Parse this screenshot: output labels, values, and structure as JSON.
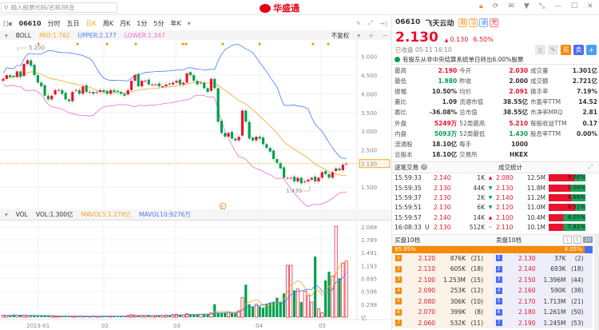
{
  "header": {
    "search_placeholder": "输入股票代码/名称/拼音",
    "logo_text": "华盛通"
  },
  "toolbar": {
    "code": "06610",
    "periods": [
      "分时",
      "五日",
      "日K",
      "周K",
      "月K",
      "1分",
      "5分",
      "年K"
    ],
    "active_period": "日K"
  },
  "boll": {
    "label": "BOLL",
    "mid": "MID:1.762",
    "upper": "UPPER:2.177",
    "lower": "LOWER:1.347",
    "adjust": "不复权"
  },
  "vol": {
    "label": "VOL",
    "vol": "VOL:1.300亿",
    "mavol5": "MAVOL5:1.278亿",
    "mavol10": "MAVOL10:9276万"
  },
  "colors": {
    "up": "#e8132d",
    "down": "#00a04e",
    "mid": "#f5a623",
    "upper": "#4a7cf7",
    "lower": "#f06bd0"
  },
  "chart_data": {
    "type": "candlestick",
    "price_ticks": [
      "5.000",
      "4.500",
      "4.000",
      "3.500",
      "3.000",
      "2.500",
      "1.500"
    ],
    "price_range": [
      1.0,
      5.45
    ],
    "last_price_label": "2.130",
    "high_label": "5.200",
    "low_label": "1.430",
    "x_labels": [
      "2023-01",
      "02",
      "03",
      "04",
      "05"
    ],
    "closes": [
      4.4,
      4.5,
      4.45,
      4.45,
      4.6,
      4.45,
      4.8,
      4.9,
      4.75,
      4.5,
      4.3,
      4.2,
      3.95,
      3.85,
      3.95,
      4.1,
      4.1,
      4.0,
      3.85,
      3.8,
      4.05,
      4.1,
      4.0,
      4.2,
      4.05,
      4.05,
      4.0,
      4.05,
      4.1,
      4.05,
      4.0,
      4.1,
      4.05,
      4.05,
      4.0,
      3.95,
      4.1,
      4.35,
      4.5,
      4.2,
      4.35,
      4.35,
      4.25,
      4.25,
      4.25,
      4.2,
      4.2,
      4.25,
      4.25,
      4.3,
      4.35,
      4.25,
      4.3,
      4.55,
      4.5,
      4.35,
      4.25,
      4.3,
      4.15,
      4.05,
      4.4,
      4.15,
      3.25,
      2.95,
      2.85,
      2.95,
      2.8,
      2.75,
      2.85,
      3.55,
      3.25,
      2.8,
      2.75,
      2.85,
      2.8,
      2.65,
      2.55,
      2.45,
      2.25,
      2.15,
      2.0,
      1.75,
      1.75,
      1.75,
      1.65,
      1.75,
      1.6,
      1.65,
      1.7,
      1.75,
      1.65,
      1.75,
      1.9,
      1.85,
      1.75,
      1.9,
      2.0,
      1.95,
      2.1,
      2.13
    ],
    "volume_ticks": [
      "2.088",
      "1.789",
      "1.491",
      "1.193",
      "0.895",
      "0.596",
      "0.298",
      "亿"
    ],
    "volume_range": [
      0,
      2.2
    ],
    "volumes": [
      0.05,
      0.04,
      0.03,
      0.06,
      0.05,
      0.04,
      0.05,
      0.04,
      0.03,
      0.04,
      0.03,
      0.03,
      0.04,
      0.03,
      0.03,
      0.02,
      0.02,
      0.03,
      0.03,
      0.02,
      0.02,
      0.03,
      0.02,
      0.03,
      0.02,
      0.02,
      0.03,
      0.02,
      0.02,
      0.03,
      0.02,
      0.03,
      0.03,
      0.02,
      0.03,
      0.03,
      0.04,
      0.06,
      0.05,
      0.04,
      0.05,
      0.04,
      0.04,
      0.04,
      0.03,
      0.04,
      0.04,
      0.05,
      0.05,
      0.06,
      0.07,
      0.06,
      0.06,
      0.08,
      0.07,
      0.06,
      0.06,
      0.07,
      0.08,
      0.08,
      0.1,
      0.3,
      0.1,
      0.1,
      0.1,
      0.1,
      0.1,
      0.1,
      0.15,
      0.45,
      0.75,
      0.3,
      0.25,
      0.3,
      0.25,
      0.22,
      0.3,
      0.33,
      0.35,
      0.45,
      0.35,
      0.55,
      1.2,
      1.2,
      0.62,
      0.65,
      0.35,
      0.6,
      0.5,
      0.35,
      1.4,
      0.2,
      0.1,
      0.85,
      1.05,
      0.95,
      2.1,
      0.9,
      1.25,
      1.3
    ]
  },
  "quote": {
    "code": "06610",
    "name": "飞天云动",
    "badges": [
      "融",
      "沽",
      "通",
      "完"
    ],
    "price": "2.130",
    "change": "0.130",
    "change_pct": "6.50%",
    "status": "已收盘 05-11 16:10",
    "notice": "有股东从非中央结算系统单日转出6.00%股票",
    "stats": [
      [
        {
          "l": "最高",
          "v": "2.190",
          "c": "red"
        },
        {
          "l": "今开",
          "v": "2.030",
          "c": "red"
        },
        {
          "l": "成交量",
          "v": "1.301亿",
          "c": ""
        }
      ],
      [
        {
          "l": "最低",
          "v": "1.980",
          "c": "grn"
        },
        {
          "l": "昨收",
          "v": "2.000",
          "c": ""
        },
        {
          "l": "成交额",
          "v": "2.721亿",
          "c": ""
        }
      ],
      [
        {
          "l": "振幅",
          "v": "10.50%",
          "c": ""
        },
        {
          "l": "均价",
          "v": "2.091",
          "c": "red"
        },
        {
          "l": "换手率",
          "v": "7.19%",
          "c": ""
        }
      ],
      [
        {
          "l": "量比",
          "v": "1.09",
          "c": ""
        },
        {
          "l": "流通市值",
          "v": "38.55亿",
          "c": ""
        },
        {
          "l": "市盈率TTM",
          "v": "14.52",
          "c": ""
        }
      ],
      [
        {
          "l": "委比",
          "v": "-36.08%",
          "c": ""
        },
        {
          "l": "总市值",
          "v": "38.55亿",
          "c": ""
        },
        {
          "l": "市净率MRQ",
          "v": "2.81",
          "c": ""
        }
      ],
      [
        {
          "l": "外盘",
          "v": "5249万",
          "c": "red"
        },
        {
          "l": "52周最高",
          "v": "5.210",
          "c": "red"
        },
        {
          "l": "每股收益TTM",
          "v": "0.17",
          "c": ""
        }
      ],
      [
        {
          "l": "内盘",
          "v": "5093万",
          "c": "grn"
        },
        {
          "l": "52周最低",
          "v": "1.430",
          "c": "grn"
        },
        {
          "l": "股息率TTM",
          "v": "0.00%",
          "c": ""
        }
      ],
      [
        {
          "l": "流通股",
          "v": "18.10亿",
          "c": ""
        },
        {
          "l": "每手",
          "v": "1000",
          "c": ""
        },
        {
          "l": "",
          "v": "",
          "c": ""
        }
      ],
      [
        {
          "l": "总股本",
          "v": "18.10亿",
          "c": ""
        },
        {
          "l": "交易所",
          "v": "HKEX",
          "c": ""
        },
        {
          "l": "",
          "v": "",
          "c": ""
        }
      ]
    ]
  },
  "trades": {
    "title": "逐笔交易",
    "stats_title": "成交统计",
    "rows": [
      {
        "time": "15:59:33",
        "flag": "",
        "price": "2.140",
        "vol": "1K",
        "dir": "up"
      },
      {
        "time": "15:59:35",
        "flag": "",
        "price": "2.130",
        "vol": "44K",
        "dir": "down"
      },
      {
        "time": "15:59:37",
        "flag": "",
        "price": "2.130",
        "vol": "2K",
        "dir": "down"
      },
      {
        "time": "15:59:51",
        "flag": "",
        "price": "2.130",
        "vol": "6K",
        "dir": "down"
      },
      {
        "time": "15:59:57",
        "flag": "",
        "price": "2.140",
        "vol": "14K",
        "dir": "up"
      },
      {
        "time": "16:08:33",
        "flag": "U",
        "price": "2.130",
        "vol": "512K",
        "dir": "flat"
      }
    ],
    "stats": [
      {
        "price": "2.080",
        "vol": "12.5M",
        "pct": "9.66%",
        "buy": 0.7
      },
      {
        "price": "2.130",
        "vol": "11.8M",
        "pct": "9.08%",
        "buy": 0.6
      },
      {
        "price": "2.140",
        "vol": "11.2M",
        "pct": "8.68%",
        "buy": 0.62
      },
      {
        "price": "2.120",
        "vol": "11.0M",
        "pct": "8.51%",
        "buy": 0.72
      },
      {
        "price": "2.100",
        "vol": "10.4M",
        "pct": "8.05%",
        "buy": 0.4
      },
      {
        "price": "2.110",
        "vol": "10.1M",
        "pct": "7.81%",
        "buy": 0.4
      }
    ]
  },
  "orderbook": {
    "bid_title": "买盘10档",
    "ask_title": "卖盘10档",
    "depth_options": [
      "1",
      "5",
      "10"
    ],
    "bid_pct": "95.95%",
    "ask_pct": "4.05%",
    "bid_ratio": 0.9595,
    "bids": [
      {
        "n": "1",
        "p": "2.120",
        "v": "876K",
        "c": "(21)"
      },
      {
        "n": "2",
        "p": "2.110",
        "v": "605K",
        "c": "(18)"
      },
      {
        "n": "3",
        "p": "2.100",
        "v": "1.253M",
        "c": "(15)"
      },
      {
        "n": "4",
        "p": "2.090",
        "v": "253K",
        "c": "(12)"
      },
      {
        "n": "5",
        "p": "2.080",
        "v": "306K",
        "c": "(10)"
      },
      {
        "n": "6",
        "p": "2.070",
        "v": "399K",
        "c": "(8)"
      },
      {
        "n": "7",
        "p": "2.060",
        "v": "532K",
        "c": "(11)"
      }
    ],
    "asks": [
      {
        "n": "1",
        "p": "2.130",
        "v": "37K",
        "c": "(2)"
      },
      {
        "n": "2",
        "p": "2.140",
        "v": "693K",
        "c": "(18)"
      },
      {
        "n": "3",
        "p": "2.150",
        "v": "1.396M",
        "c": "(44)"
      },
      {
        "n": "4",
        "p": "2.160",
        "v": "590K",
        "c": "(38)"
      },
      {
        "n": "5",
        "p": "2.170",
        "v": "1.713M",
        "c": "(21)"
      },
      {
        "n": "6",
        "p": "2.180",
        "v": "1.261M",
        "c": "(50)"
      },
      {
        "n": "7",
        "p": "2.190",
        "v": "1.245M",
        "c": "(53)"
      }
    ]
  }
}
